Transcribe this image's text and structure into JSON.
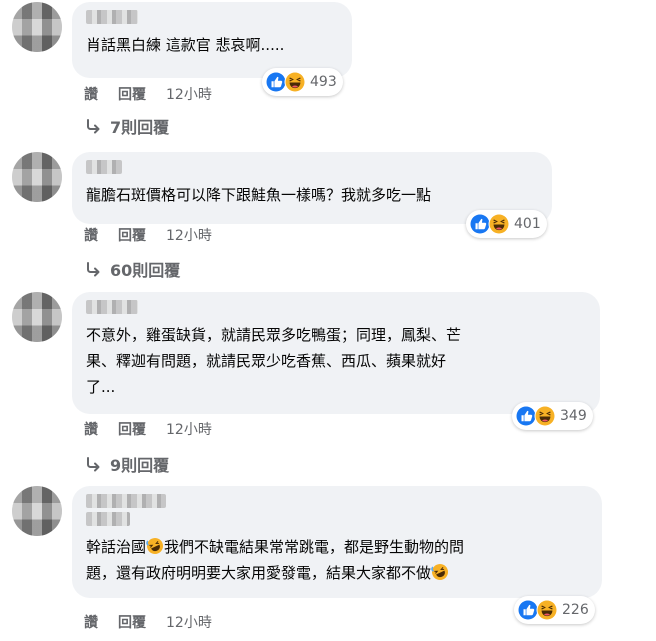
{
  "comments": [
    {
      "text": "肖話黑白練 這款官 悲哀啊.....",
      "reaction_count": "493",
      "actions": {
        "like": "讚",
        "reply": "回覆",
        "time": "12小時"
      },
      "replies": "7則回覆"
    },
    {
      "text": "龍膽石斑價格可以降下跟鮭魚一樣嗎？我就多吃一點",
      "reaction_count": "401",
      "actions": {
        "like": "讚",
        "reply": "回覆",
        "time": "12小時"
      },
      "replies": "60則回覆"
    },
    {
      "text_line1": "不意外，雞蛋缺貨，就請民眾多吃鴨蛋；同理，鳳梨、芒",
      "text_line2": "果、釋迦有問題，就請民眾少吃香蕉、西瓜、蘋果就好",
      "text_line3": "了...",
      "reaction_count": "349",
      "actions": {
        "like": "讚",
        "reply": "回覆",
        "time": "12小時"
      },
      "replies": "9則回覆"
    },
    {
      "text_line1_a": "幹話治國",
      "text_line1_b": "我們不缺電結果常常跳電，都是野生動物的問",
      "text_line2": "題，還有政府明明要大家用愛發電，結果大家都不做",
      "reaction_count": "226",
      "actions": {
        "like": "讚",
        "reply": "回覆",
        "time": "12小時"
      }
    }
  ],
  "colors": {
    "bubble": "#f0f2f5",
    "like_blue": "#1877f2",
    "haha_yellow": "#f7b125",
    "meta_gray": "#65676b"
  },
  "icons": {
    "like": "like-reaction-icon",
    "haha": "haha-reaction-icon",
    "reply_arrow": "reply-arrow-icon"
  }
}
